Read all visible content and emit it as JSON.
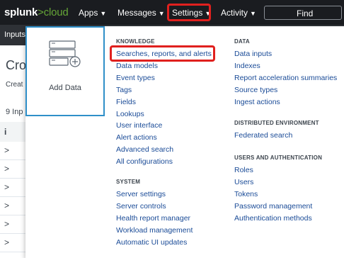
{
  "brand": {
    "splunk": "splunk",
    "gt": ">",
    "cloud": "cloud"
  },
  "topnav": {
    "apps": "Apps",
    "messages": "Messages",
    "settings": "Settings",
    "activity": "Activity",
    "caret": "▼",
    "find_label": "Find"
  },
  "subnav": {
    "label": "Inputs"
  },
  "background": {
    "title": "Cro",
    "subtitle": "Creat",
    "count": "9 Inp",
    "header_icon": "i",
    "row_chevron": ">"
  },
  "add_data": {
    "label": "Add Data"
  },
  "menu": {
    "knowledge": {
      "heading": "KNOWLEDGE",
      "items": [
        "Searches, reports, and alerts",
        "Data models",
        "Event types",
        "Tags",
        "Fields",
        "Lookups",
        "User interface",
        "Alert actions",
        "Advanced search",
        "All configurations"
      ]
    },
    "system": {
      "heading": "SYSTEM",
      "items": [
        "Server settings",
        "Server controls",
        "Health report manager",
        "Workload management",
        "Automatic UI updates"
      ]
    },
    "data": {
      "heading": "DATA",
      "items": [
        "Data inputs",
        "Indexes",
        "Report acceleration summaries",
        "Source types",
        "Ingest actions"
      ]
    },
    "distributed": {
      "heading": "DISTRIBUTED ENVIRONMENT",
      "items": [
        "Federated search"
      ]
    },
    "users": {
      "heading": "USERS AND AUTHENTICATION",
      "items": [
        "Roles",
        "Users",
        "Tokens",
        "Password management",
        "Authentication methods"
      ]
    }
  },
  "colors": {
    "topbar": "#1a1c20",
    "subbar": "#2e3136",
    "link": "#1a4b97",
    "highlight": "#e0201e",
    "brand_green": "#65a637",
    "tile_border": "#2f8fc9"
  }
}
